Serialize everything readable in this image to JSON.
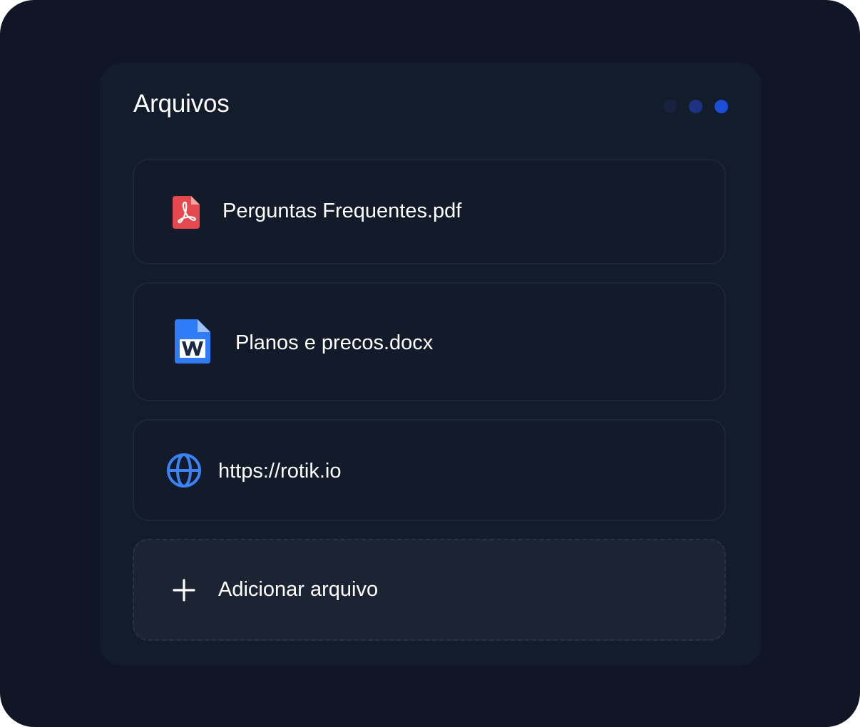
{
  "panel": {
    "title": "Arquivos",
    "dots": [
      {
        "name": "dot-1",
        "color": "#16223e"
      },
      {
        "name": "dot-2",
        "color": "#1a3383"
      },
      {
        "name": "dot-3",
        "color": "#1d4ed8"
      }
    ]
  },
  "files": [
    {
      "name": "Perguntas Frequentes.pdf",
      "icon": "pdf-file-icon",
      "icon_color": "#e5484d"
    },
    {
      "name": "Planos e precos.docx",
      "icon": "word-file-icon",
      "icon_color": "#2f7cf6"
    },
    {
      "name": "https://rotik.io",
      "icon": "globe-icon",
      "icon_color": "#3b82f6"
    }
  ],
  "add_file": {
    "label": "Adicionar arquivo",
    "icon": "plus-icon"
  },
  "colors": {
    "background": "#111626",
    "panel": "#131c2b",
    "card_border": "#1c2638",
    "add_card": "#1c2434",
    "text": "#ffffff"
  }
}
